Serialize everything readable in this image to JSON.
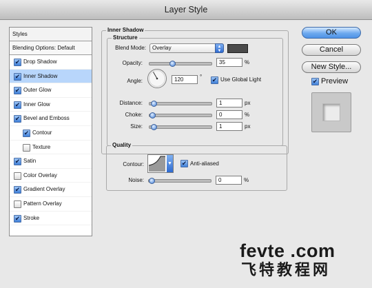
{
  "window": {
    "title": "Layer Style"
  },
  "styles_panel": {
    "header": "Styles",
    "blending": "Blending Options: Default",
    "items": [
      {
        "label": "Drop Shadow",
        "checked": true,
        "indent": false,
        "selected": false
      },
      {
        "label": "Inner Shadow",
        "checked": true,
        "indent": false,
        "selected": true
      },
      {
        "label": "Outer Glow",
        "checked": true,
        "indent": false,
        "selected": false
      },
      {
        "label": "Inner Glow",
        "checked": true,
        "indent": false,
        "selected": false
      },
      {
        "label": "Bevel and Emboss",
        "checked": true,
        "indent": false,
        "selected": false
      },
      {
        "label": "Contour",
        "checked": true,
        "indent": true,
        "selected": false
      },
      {
        "label": "Texture",
        "checked": false,
        "indent": true,
        "selected": false
      },
      {
        "label": "Satin",
        "checked": true,
        "indent": false,
        "selected": false
      },
      {
        "label": "Color Overlay",
        "checked": false,
        "indent": false,
        "selected": false
      },
      {
        "label": "Gradient Overlay",
        "checked": true,
        "indent": false,
        "selected": false
      },
      {
        "label": "Pattern Overlay",
        "checked": false,
        "indent": false,
        "selected": false
      },
      {
        "label": "Stroke",
        "checked": true,
        "indent": false,
        "selected": false
      }
    ]
  },
  "inner_shadow": {
    "section_title": "Inner Shadow",
    "structure_title": "Structure",
    "blend_mode_label": "Blend Mode:",
    "blend_mode_value": "Overlay",
    "blend_color": "#4a4a4a",
    "opacity_label": "Opacity:",
    "opacity_value": "35",
    "opacity_unit": "%",
    "opacity_level": 0.35,
    "angle_label": "Angle:",
    "angle_value": "120",
    "angle_unit": "°",
    "use_global_light_label": "Use Global Light",
    "use_global_light_checked": true,
    "distance_label": "Distance:",
    "distance_value": "1",
    "distance_unit": "px",
    "distance_level": 0.02,
    "choke_label": "Choke:",
    "choke_value": "0",
    "choke_unit": "%",
    "choke_level": 0,
    "size_label": "Size:",
    "size_value": "1",
    "size_unit": "px",
    "size_level": 0.02
  },
  "quality": {
    "title": "Quality",
    "contour_label": "Contour:",
    "anti_aliased_label": "Anti-aliased",
    "anti_aliased_checked": true,
    "noise_label": "Noise:",
    "noise_value": "0",
    "noise_unit": "%",
    "noise_level": 0
  },
  "buttons": {
    "ok": "OK",
    "cancel": "Cancel",
    "new_style": "New Style..."
  },
  "preview": {
    "label": "Preview",
    "checked": true
  },
  "watermark": {
    "line1": "fevte .com",
    "line2": "飞特教程网"
  },
  "colors": {
    "selection": "#b8d6fb",
    "accent": "#4e92e6"
  }
}
